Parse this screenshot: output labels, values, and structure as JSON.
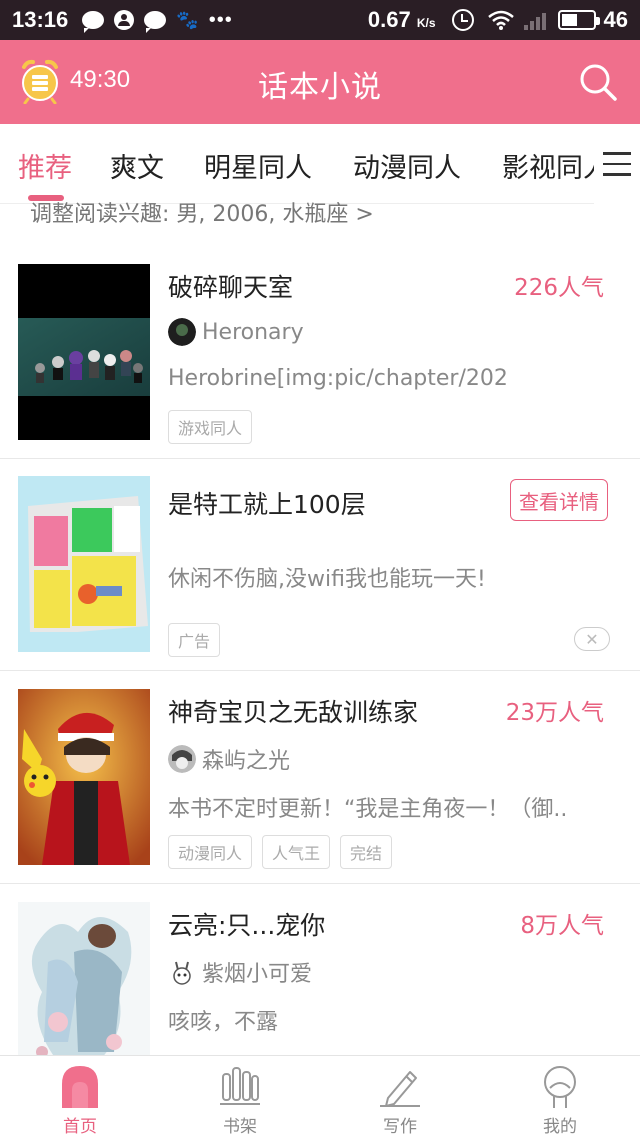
{
  "status_bar": {
    "time": "13:16",
    "speed": "0.67",
    "speed_unit": "K/s",
    "battery": "46",
    "paw_label": "du"
  },
  "header": {
    "timer": "49:30",
    "title": "话本小说",
    "accent_color": "#f06f8c"
  },
  "tabs": [
    {
      "label": "推荐"
    },
    {
      "label": "爽文"
    },
    {
      "label": "明星同人"
    },
    {
      "label": "动漫同人"
    },
    {
      "label": "影视同人"
    }
  ],
  "interest": {
    "text": "调整阅读兴趣: 男, 2006, 水瓶座 >"
  },
  "items": [
    {
      "title": "破碎聊天室",
      "popularity": "226人气",
      "author": "Heronary",
      "description": "Herobrine[img:pic/chapter/202",
      "tags": [
        "游戏同人"
      ]
    },
    {
      "title": "是特工就上100层",
      "action": "查看详情",
      "description": "休闲不伤脑,没wifi我也能玩一天!",
      "tags": [
        "广告"
      ],
      "close": "✕"
    },
    {
      "title": "神奇宝贝之无敌训练家",
      "popularity": "23万人气",
      "author": "森屿之光",
      "description": "本书不定时更新！“我是主角夜一！（御..",
      "tags": [
        "动漫同人",
        "人气王",
        "完结"
      ]
    },
    {
      "title": "云亮:只...宠你",
      "popularity": "8万人气",
      "author": "紫烟小可爱",
      "description": "咳咳，不露"
    }
  ],
  "bottom_nav": [
    {
      "label": "首页",
      "icon": "home-icon"
    },
    {
      "label": "书架",
      "icon": "bookshelf-icon"
    },
    {
      "label": "写作",
      "icon": "pen-icon"
    },
    {
      "label": "我的",
      "icon": "profile-icon"
    }
  ]
}
